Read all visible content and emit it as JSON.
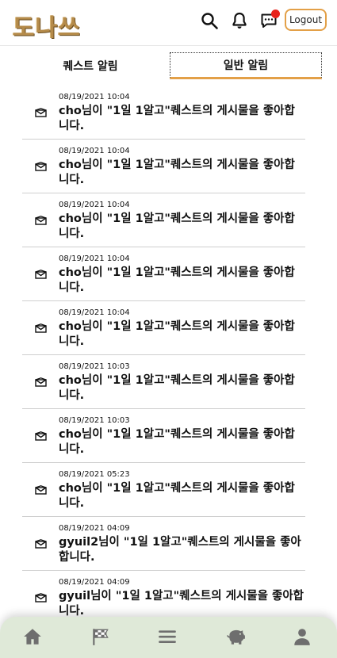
{
  "header": {
    "logo": "도나쓰",
    "logout_label": "Logout"
  },
  "icons": {
    "search": "search-icon",
    "bell": "bell-icon",
    "chat": "chat-icon",
    "notification_dot_color": "#e8221a",
    "accent": "#e3a048",
    "nav_bg": "#dfe9d8"
  },
  "tabs": [
    {
      "label": "퀘스트 알림",
      "active": false
    },
    {
      "label": "일반 알림",
      "active": true
    }
  ],
  "notifications": [
    {
      "date": "08/19/2021 10:04",
      "message": "cho님이 \"1일 1알고\"퀘스트의 게시물을 좋아합니다."
    },
    {
      "date": "08/19/2021 10:04",
      "message": "cho님이 \"1일 1알고\"퀘스트의 게시물을 좋아합니다."
    },
    {
      "date": "08/19/2021 10:04",
      "message": "cho님이 \"1일 1알고\"퀘스트의 게시물을 좋아합니다."
    },
    {
      "date": "08/19/2021 10:04",
      "message": "cho님이 \"1일 1알고\"퀘스트의 게시물을 좋아합니다."
    },
    {
      "date": "08/19/2021 10:04",
      "message": "cho님이 \"1일 1알고\"퀘스트의 게시물을 좋아합니다."
    },
    {
      "date": "08/19/2021 10:03",
      "message": "cho님이 \"1일 1알고\"퀘스트의 게시물을 좋아합니다."
    },
    {
      "date": "08/19/2021 10:03",
      "message": "cho님이 \"1일 1알고\"퀘스트의 게시물을 좋아합니다."
    },
    {
      "date": "08/19/2021 05:23",
      "message": "cho님이 \"1일 1알고\"퀘스트의 게시물을 좋아합니다."
    },
    {
      "date": "08/19/2021 04:09",
      "message": "gyuil2님이 \"1일 1알고\"퀘스트의 게시물을 좋아합니다."
    },
    {
      "date": "08/19/2021 04:09",
      "message": "gyuil님이 \"1일 1알고\"퀘스트의 게시물을 좋아합니다."
    }
  ],
  "bottom_nav": [
    {
      "name": "home-icon"
    },
    {
      "name": "checkered-flag-icon"
    },
    {
      "name": "menu-icon"
    },
    {
      "name": "piggy-bank-icon"
    },
    {
      "name": "person-icon"
    }
  ]
}
